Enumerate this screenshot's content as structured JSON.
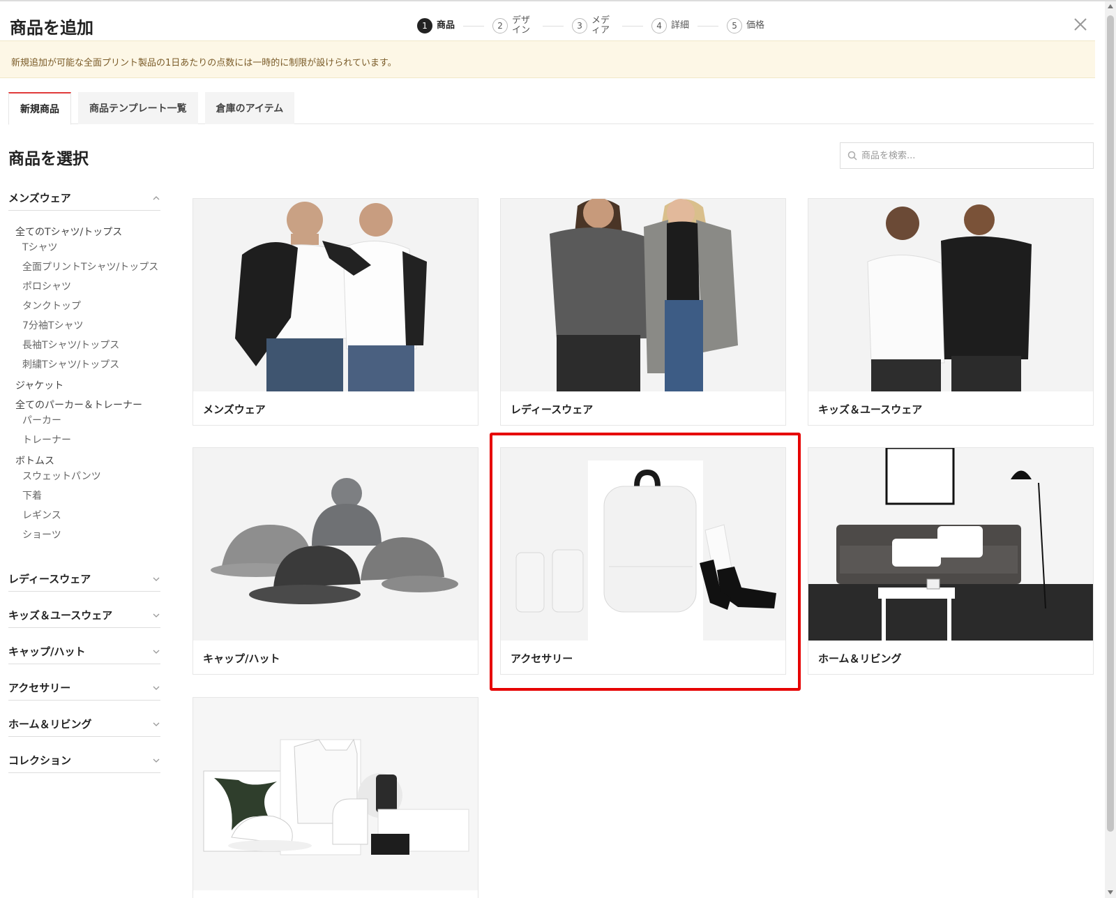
{
  "header": {
    "title": "商品を追加",
    "steps": [
      {
        "num": "1",
        "label": "商品"
      },
      {
        "num": "2",
        "label": "デザイン"
      },
      {
        "num": "3",
        "label": "メディア"
      },
      {
        "num": "4",
        "label": "詳細"
      },
      {
        "num": "5",
        "label": "価格"
      }
    ]
  },
  "notice": "新規追加が可能な全面プリント製品の1日あたりの点数には一時的に制限が設けられています。",
  "tabs": [
    "新規商品",
    "商品テンプレート一覧",
    "倉庫のアイテム"
  ],
  "section_title": "商品を選択",
  "search": {
    "placeholder": "商品を検索..."
  },
  "sidebar": {
    "mens": {
      "label": "メンズウェア",
      "tshirts_title": "全てのTシャツ/トップス",
      "tshirts": [
        "Tシャツ",
        "全面プリントTシャツ/トップス",
        "ポロシャツ",
        "タンクトップ",
        "7分袖Tシャツ",
        "長袖Tシャツ/トップス",
        "刺繍Tシャツ/トップス"
      ],
      "jacket": "ジャケット",
      "hoodies_title": "全てのパーカー＆トレーナー",
      "hoodies": [
        "パーカー",
        "トレーナー"
      ],
      "bottoms_title": "ボトムス",
      "bottoms": [
        "スウェットパンツ",
        "下着",
        "レギンス",
        "ショーツ"
      ]
    },
    "collapsed": [
      "レディースウェア",
      "キッズ＆ユースウェア",
      "キャップ/ハット",
      "アクセサリー",
      "ホーム＆リビング",
      "コレクション"
    ]
  },
  "cards": [
    "メンズウェア",
    "レディースウェア",
    "キッズ＆ユースウェア",
    "キャップ/ハット",
    "アクセサリー",
    "ホーム＆リビング"
  ],
  "colors": {
    "accent": "#e03a3a",
    "highlight": "#e60000",
    "notice_bg": "#fdf7e6",
    "notice_text": "#7a5b28"
  }
}
